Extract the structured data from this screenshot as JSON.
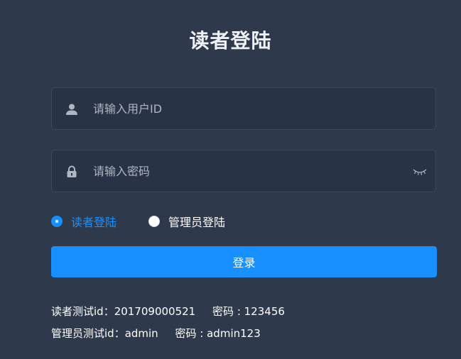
{
  "title": "读者登陆",
  "form": {
    "user_placeholder": "请输入用户ID",
    "user_value": "",
    "password_placeholder": "请输入密码",
    "password_value": "",
    "icons": {
      "user": "user-icon",
      "password": "lock-icon",
      "toggle_visibility": "eye-closed-icon"
    }
  },
  "role": {
    "options": [
      {
        "label": "读者登陆",
        "selected": true
      },
      {
        "label": "管理员登陆",
        "selected": false
      }
    ]
  },
  "login_button": {
    "label": "登录"
  },
  "tips": {
    "reader": "读者测试id：201709000521     密码 : 123456",
    "admin": "管理员测试id：admin     密码 : admin123"
  },
  "colors": {
    "background": "#2e3a4b",
    "input_background": "#283446",
    "accent": "#1890ff",
    "text": "#ffffff",
    "placeholder": "#aeb6c2"
  }
}
